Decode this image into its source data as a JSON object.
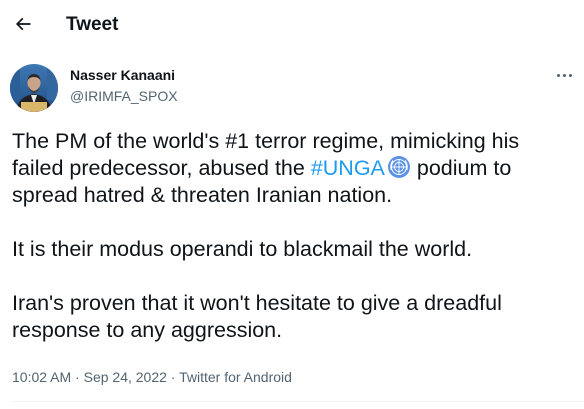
{
  "header": {
    "back_icon": "arrow-left-icon",
    "title": "Tweet"
  },
  "author": {
    "name": "Nasser Kanaani",
    "handle": "@IRIMFA_SPOX",
    "avatar_icon": "profile-photo"
  },
  "more_icon": "ellipsis-icon",
  "tweet": {
    "part1": "The PM of the world's #1 terror regime, mimicking his failed predecessor, abused the ",
    "hashtag": "#UNGA",
    "hashflag_icon": "un-emblem-icon",
    "part2": " podium to spread hatred & threaten Iranian nation.\n\nIt is their modus operandi to blackmail the world.\n\nIran's proven that it won't hesitate to give a dreadful response to any aggression."
  },
  "meta": {
    "time": "10:02 AM",
    "separator1": " · ",
    "date": "Sep 24, 2022",
    "separator2": " · ",
    "source": "Twitter for Android"
  },
  "colors": {
    "text": "#0f1419",
    "secondary": "#536471",
    "link": "#1d9bf0",
    "divider": "#eff3f4"
  }
}
